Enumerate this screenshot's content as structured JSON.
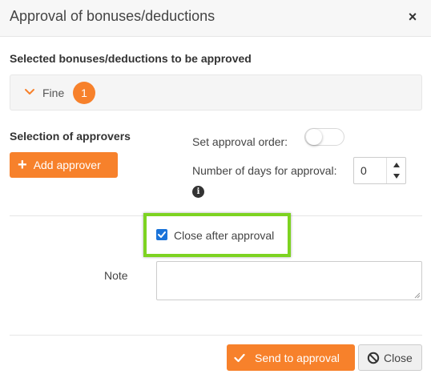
{
  "dialog": {
    "title": "Approval of bonuses/deductions",
    "close_glyph": "×"
  },
  "selected_section": {
    "heading": "Selected bonuses/deductions to be approved",
    "group_label": "Fine",
    "group_count": "1",
    "expand_icon": "chevron-down-icon"
  },
  "approvers": {
    "heading": "Selection of approvers",
    "add_button_label": "Add approver",
    "add_icon": "plus-icon"
  },
  "approval_order": {
    "label": "Set approval order:",
    "enabled": false
  },
  "days_for_approval": {
    "label": "Number of days for approval:",
    "value": "0",
    "info_glyph": "i"
  },
  "close_after_approval": {
    "label": "Close after approval",
    "checked": true,
    "highlight_color": "#7dd321"
  },
  "note": {
    "label": "Note",
    "value": ""
  },
  "footer": {
    "send_label": "Send to approval",
    "close_label": "Close"
  },
  "colors": {
    "accent": "#f7812b",
    "checkbox": "#1a73d9"
  }
}
